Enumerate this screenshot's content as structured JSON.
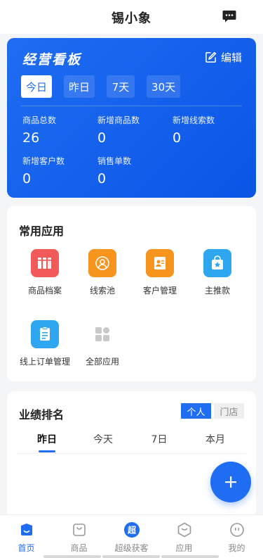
{
  "app": {
    "title": "锡小象"
  },
  "dashboard": {
    "title": "经营看板",
    "edit_label": "编辑",
    "tabs": [
      "今日",
      "昨日",
      "7天",
      "30天"
    ],
    "stats": [
      {
        "label": "商品总数",
        "value": "26"
      },
      {
        "label": "新增商品数",
        "value": "0"
      },
      {
        "label": "新增线索数",
        "value": "0"
      },
      {
        "label": "新增客户数",
        "value": "0"
      },
      {
        "label": "销售单数",
        "value": "0"
      }
    ]
  },
  "apps": {
    "title": "常用应用",
    "items": [
      {
        "label": "商品档案",
        "icon": "product-archive-icon",
        "color": "#f25a5a"
      },
      {
        "label": "线索池",
        "icon": "lead-pool-icon",
        "color": "#f7941d"
      },
      {
        "label": "客户管理",
        "icon": "customer-card-icon",
        "color": "#f7941d"
      },
      {
        "label": "主推款",
        "icon": "featured-bag-icon",
        "color": "#2ea7f0"
      },
      {
        "label": "线上订单管理",
        "icon": "online-order-icon",
        "color": "#2ea7f0"
      },
      {
        "label": "全部应用",
        "icon": "all-apps-icon",
        "color": "#c8c8c8"
      }
    ]
  },
  "performance": {
    "title": "业绩排名",
    "toggle": [
      "个人",
      "门店"
    ],
    "tabs": [
      "昨日",
      "今天",
      "7日",
      "本月"
    ]
  },
  "bottom_nav": [
    {
      "label": "首页",
      "icon": "home-icon"
    },
    {
      "label": "商品",
      "icon": "product-bag-icon"
    },
    {
      "label": "超级获客",
      "icon": "super-acquire-icon",
      "badge": "超"
    },
    {
      "label": "应用",
      "icon": "apps-box-icon"
    },
    {
      "label": "我的",
      "icon": "profile-icon"
    }
  ],
  "colors": {
    "accent": "#1f6df2"
  }
}
